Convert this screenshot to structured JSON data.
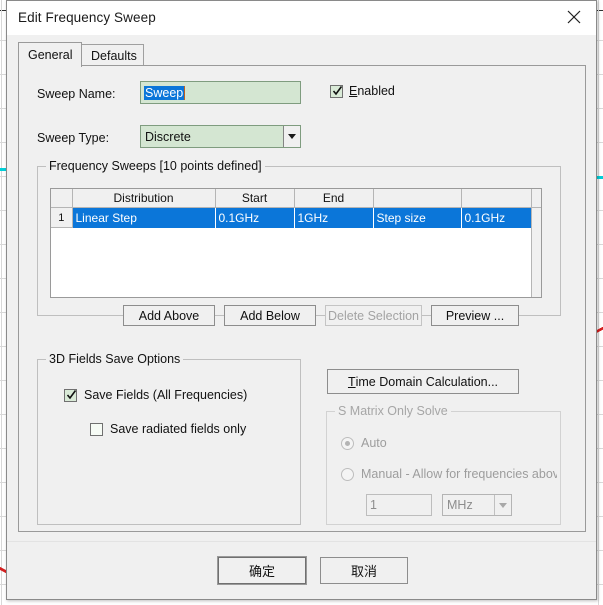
{
  "window": {
    "title": "Edit Frequency Sweep",
    "close_icon": "close-icon"
  },
  "tabs": [
    {
      "label": "General",
      "active": true
    },
    {
      "label": "Defaults",
      "active": false
    }
  ],
  "general": {
    "sweep_name_label": "Sweep Name:",
    "sweep_name_value": "Sweep",
    "sweep_name_placeholder": "Sweep",
    "enabled_label": "Enabled",
    "enabled_accel": "E",
    "enabled_rest": "nabled",
    "enabled_checked": true,
    "sweep_type_label": "Sweep Type:",
    "sweep_type_value": "Discrete"
  },
  "frequency_sweeps": {
    "group_title": "Frequency Sweeps [10 points defined]",
    "columns": [
      "",
      "Distribution",
      "Start",
      "End",
      "",
      ""
    ],
    "rows": [
      {
        "index": "1",
        "distribution": "Linear Step",
        "start": "0.1GHz",
        "end": "1GHz",
        "extra_label": "Step size",
        "extra_value": "0.1GHz",
        "selected": true
      }
    ],
    "buttons": [
      {
        "label": "Add Above",
        "enabled": true
      },
      {
        "label": "Add Below",
        "enabled": true
      },
      {
        "label": "Delete Selection",
        "enabled": false
      },
      {
        "label": "Preview ...",
        "enabled": true
      }
    ]
  },
  "fields_save_options": {
    "group_title": "3D Fields Save Options",
    "save_fields_label": "Save Fields (All Frequencies)",
    "save_fields_checked": true,
    "save_radiated_label": "Save radiated fields only",
    "save_radiated_checked": false
  },
  "time_domain": {
    "button_accel": "T",
    "button_rest": "ime Domain Calculation...",
    "button_label": "Time Domain Calculation..."
  },
  "s_matrix_only_solve": {
    "group_title": "S Matrix Only Solve",
    "enabled": false,
    "auto_label": "Auto",
    "auto_selected": true,
    "manual_label": "Manual -  Allow for frequencies abov",
    "manual_selected": false,
    "value": "1",
    "unit": "MHz"
  },
  "footer": {
    "ok_label": "确定",
    "cancel_label": "取消"
  },
  "colors": {
    "selection_blue": "#0b76d9",
    "field_green": "#d4e6d2",
    "dialog_gray": "#f0f0f0",
    "trace_cyan": "#00cfd8",
    "trace_red": "#d42020"
  }
}
